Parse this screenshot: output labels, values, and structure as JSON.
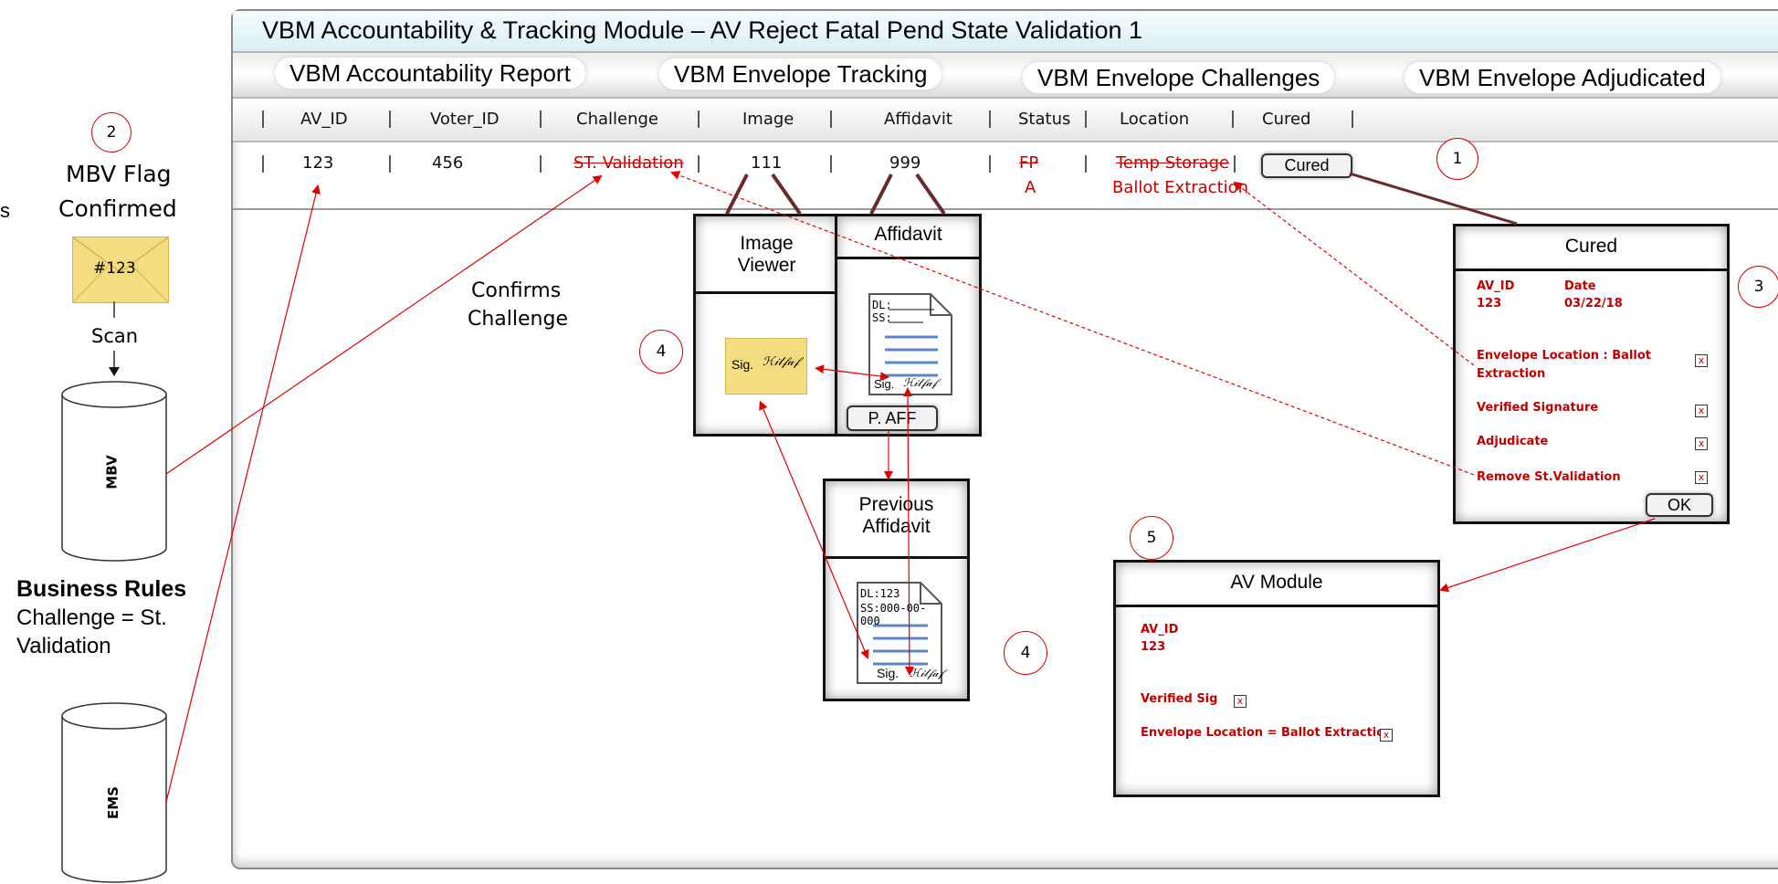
{
  "title": "VBM Accountability & Tracking Module – AV Reject Fatal Pend State Validation 1",
  "tabs": [
    "VBM Accountability Report",
    "VBM Envelope Tracking",
    "VBM Envelope Challenges",
    "VBM Envelope Adjudicated"
  ],
  "columns": [
    "AV_ID",
    "Voter_ID",
    "Challenge",
    "Image",
    "Affidavit",
    "Status",
    "Location",
    "Cured"
  ],
  "row": {
    "av_id": "123",
    "voter_id": "456",
    "challenge": "ST. Validation",
    "image": "111",
    "affidavit": "999",
    "status_old": "FP",
    "status_new": "A",
    "location_old": "Temp Storage",
    "location_new": "Ballot Extraction",
    "cured_button": "Cured"
  },
  "left": {
    "partial_text": "s",
    "step2_number": "2",
    "mbv_flag": "MBV Flag",
    "confirmed": "Confirmed",
    "envelope_label": "#123",
    "scan": "Scan",
    "mbv_db": "MBV",
    "ems_db": "EMS",
    "business_rules_title": "Business Rules",
    "business_rules_line1": "Challenge = St.",
    "business_rules_line2": "Validation",
    "confirms_1": "Confirms",
    "confirms_2": "Challenge"
  },
  "image_viewer": {
    "title_1": "Image",
    "title_2": "Viewer",
    "sig": "Sig."
  },
  "affidavit_box": {
    "title": "Affidavit",
    "dl": "DL:",
    "ss": "SS:",
    "sig": "Sig.",
    "button": "P. AFF"
  },
  "previous_affidavit": {
    "title_1": "Previous",
    "title_2": "Affidavit",
    "dl": "DL:123",
    "ss": "SS:000-00-000",
    "sig": "Sig."
  },
  "step_numbers": {
    "one": "1",
    "three": "3",
    "four_a": "4",
    "four_b": "4",
    "five": "5"
  },
  "cured_dialog": {
    "title": "Cured",
    "av_id_label": "AV_ID",
    "date_label": "Date",
    "av_id": "123",
    "date": "03/22/18",
    "items": [
      "Envelope Location : Ballot",
      "Extraction",
      "Verified Signature",
      "Adjudicate",
      "Remove St.Validation"
    ],
    "check_mark": "x",
    "ok": "OK"
  },
  "av_module": {
    "title": "AV Module",
    "av_id_label": "AV_ID",
    "av_id": "123",
    "verified_sig": "Verified Sig",
    "envelope_location": "Envelope Location = Ballot Extraction",
    "check_mark": "x"
  },
  "colors": {
    "red": "#c00000",
    "envelope": "#f4dc80",
    "title_bg": "#d9f0f7"
  }
}
